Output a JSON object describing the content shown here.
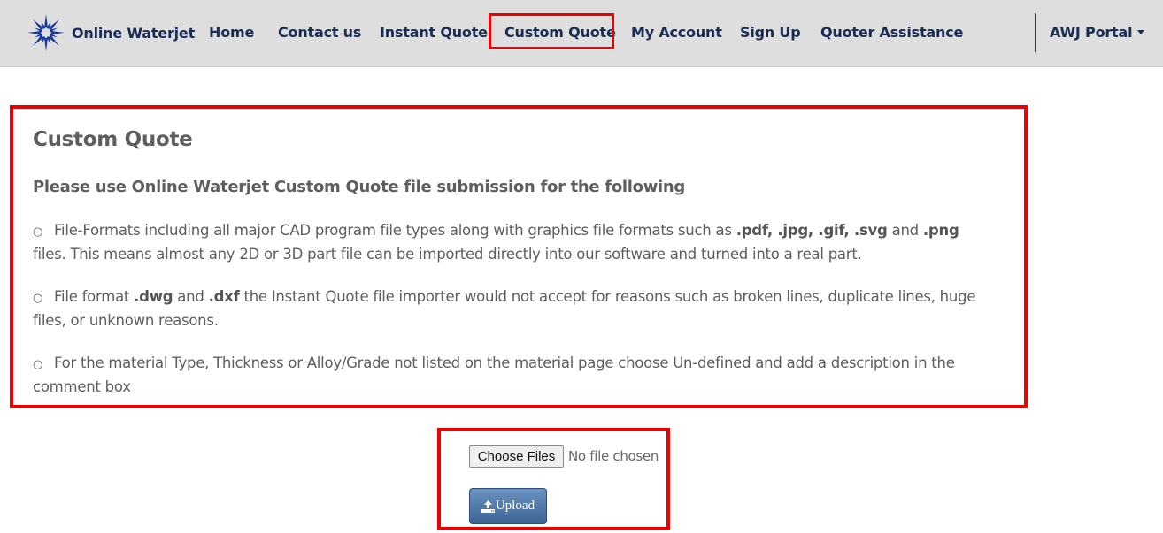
{
  "navbar": {
    "brand": "Online Waterjet",
    "items": [
      {
        "label": "Home"
      },
      {
        "label": "Contact us"
      },
      {
        "label": "Instant Quote"
      },
      {
        "label": "Custom Quote",
        "active": true
      },
      {
        "label": "My Account"
      },
      {
        "label": "Sign Up"
      },
      {
        "label": "Quoter Assistance"
      }
    ],
    "portal_dropdown": "AWJ Portal",
    "highlight_color": "#ee0000",
    "text_color": "#1a2d55"
  },
  "content": {
    "title": "Custom Quote",
    "subtitle": "Please use Online Waterjet Custom Quote file submission for the following",
    "bullets": [
      {
        "parts": [
          {
            "t": "File-Formats including all major CAD program file types along with graphics file formats such as "
          },
          {
            "t": ".pdf, .jpg, .gif, .svg",
            "b": true
          },
          {
            "t": " and "
          },
          {
            "t": ".png",
            "b": true
          },
          {
            "t": " files. This means almost any 2D or 3D part file can be imported directly into our software and turned into a real part."
          }
        ]
      },
      {
        "parts": [
          {
            "t": "File format "
          },
          {
            "t": ".dwg",
            "b": true
          },
          {
            "t": " and "
          },
          {
            "t": ".dxf",
            "b": true
          },
          {
            "t": " the Instant Quote file importer would not accept for reasons such as broken lines, duplicate lines, huge files, or unknown reasons."
          }
        ]
      },
      {
        "parts": [
          {
            "t": "For the material Type, Thickness or Alloy/Grade not listed on the material page choose Un-defined and add a description in the comment box"
          }
        ]
      }
    ],
    "bullet_glyph": "○"
  },
  "upload": {
    "choose_label": "Choose Files",
    "no_file_text": "No file chosen",
    "upload_label": "Upload",
    "upload_icon": "upload-icon"
  }
}
